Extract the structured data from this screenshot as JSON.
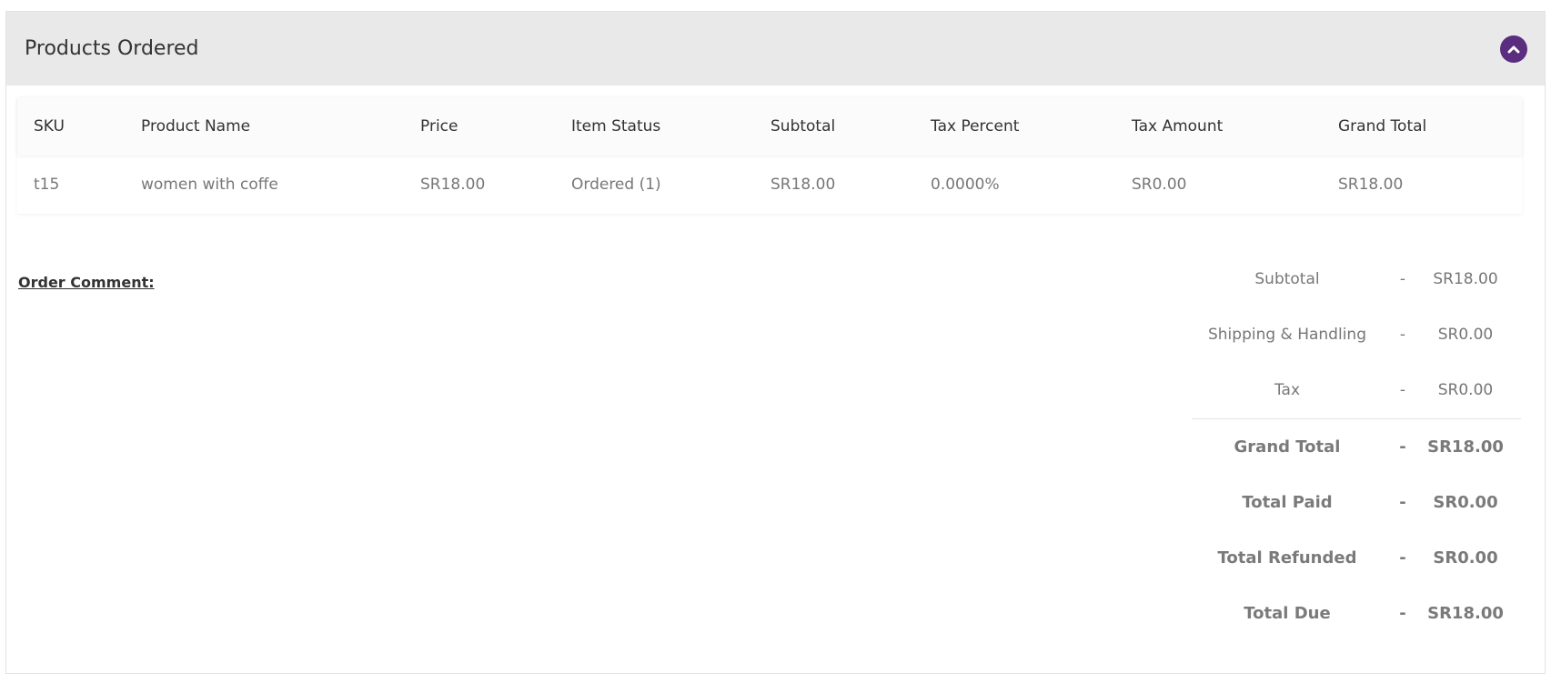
{
  "panel": {
    "title": "Products Ordered",
    "collapse_icon": "chevron-up-icon",
    "accent_color": "#5b2d7f"
  },
  "table": {
    "columns": [
      "SKU",
      "Product Name",
      "Price",
      "Item Status",
      "Subtotal",
      "Tax Percent",
      "Tax Amount",
      "Grand Total"
    ],
    "rows": [
      [
        "t15",
        "women with coffe",
        "SR18.00",
        "Ordered (1)",
        "SR18.00",
        "0.0000%",
        "SR0.00",
        "SR18.00"
      ]
    ]
  },
  "order_comment_label": "Order Comment:",
  "totals": [
    {
      "label": "Subtotal",
      "sep": "-",
      "value": "SR18.00"
    },
    {
      "label": "Shipping & Handling",
      "sep": "-",
      "value": "SR0.00"
    },
    {
      "label": "Tax",
      "sep": "-",
      "value": "SR0.00"
    },
    {
      "label": "Grand Total",
      "sep": "-",
      "value": "SR18.00"
    },
    {
      "label": "Total Paid",
      "sep": "-",
      "value": "SR0.00"
    },
    {
      "label": "Total Refunded",
      "sep": "-",
      "value": "SR0.00"
    },
    {
      "label": "Total Due",
      "sep": "-",
      "value": "SR18.00"
    }
  ]
}
